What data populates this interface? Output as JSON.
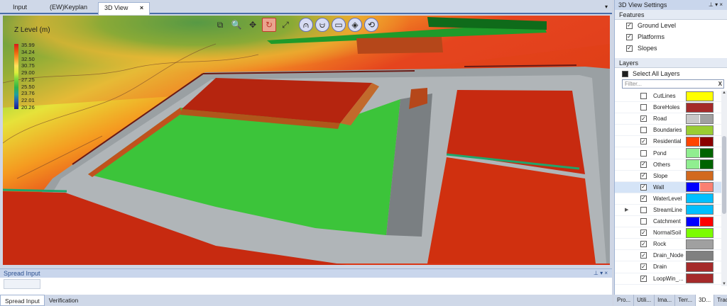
{
  "document_tabs": {
    "input": "Input",
    "keyplan": "(EW)Keyplan",
    "view3d": "3D View",
    "close_glyph": "×",
    "dropdown_glyph": "▾"
  },
  "legend": {
    "title": "Z Level (m)",
    "values": [
      "35.99",
      "34.24",
      "32.50",
      "30.75",
      "29.00",
      "27.25",
      "25.50",
      "23.76",
      "22.01",
      "20.26"
    ],
    "colors": [
      "#d7191c",
      "#ec5a0c",
      "#f89b29",
      "#fee05a",
      "#d9ef3a",
      "#6fd23b",
      "#2fb34a",
      "#1fa0a0",
      "#2755b5",
      "#1a1a8f"
    ]
  },
  "toolbar": [
    {
      "name": "zoom-window-icon",
      "glyph": "⧉",
      "style": "plain"
    },
    {
      "name": "zoom-icon",
      "glyph": "🔍",
      "style": "plain"
    },
    {
      "name": "pan-icon",
      "glyph": "✥",
      "style": "plain"
    },
    {
      "name": "rotate-icon",
      "glyph": "↻",
      "style": "active"
    },
    {
      "name": "zoom-extents-icon",
      "glyph": "⤢",
      "style": "plain"
    },
    {
      "name": "section-view-icon",
      "glyph": "⩀",
      "style": "round"
    },
    {
      "name": "profile-view-icon",
      "glyph": "⩁",
      "style": "round"
    },
    {
      "name": "plan-view-icon",
      "glyph": "▭",
      "style": "round"
    },
    {
      "name": "iso-view-icon",
      "glyph": "◈",
      "style": "round"
    },
    {
      "name": "settings-view-icon",
      "glyph": "⟲",
      "style": "round"
    }
  ],
  "settings": {
    "title": "3D View Settings",
    "pin_glyphs": "⊥ ▾ ×",
    "features_label": "Features",
    "features": [
      {
        "label": "Ground Level",
        "checked": true
      },
      {
        "label": "Platforms",
        "checked": true
      },
      {
        "label": "Slopes",
        "checked": true
      }
    ],
    "layers_label": "Layers",
    "select_all_label": "Select All Layers",
    "filter_placeholder": "Filter...",
    "filter_clear": "X",
    "layers": [
      {
        "label": "CutLines",
        "checked": false,
        "colors": [
          "#ffff00"
        ]
      },
      {
        "label": "BoreHoles",
        "checked": false,
        "colors": [
          "#a52a2a"
        ]
      },
      {
        "label": "Road",
        "checked": true,
        "colors": [
          "#c8c8c8",
          "#a0a0a0"
        ]
      },
      {
        "label": "Boundaries",
        "checked": false,
        "colors": [
          "#9acd32"
        ]
      },
      {
        "label": "Residential",
        "checked": true,
        "colors": [
          "#ff4500",
          "#8b0000"
        ]
      },
      {
        "label": "Pond",
        "checked": false,
        "colors": [
          "#90ee90",
          "#006400"
        ]
      },
      {
        "label": "Others",
        "checked": true,
        "colors": [
          "#90ee90",
          "#006400"
        ]
      },
      {
        "label": "Slope",
        "checked": true,
        "colors": [
          "#d2691e"
        ]
      },
      {
        "label": "Wall",
        "checked": true,
        "colors": [
          "#0000ff",
          "#fa8072"
        ],
        "selected": true
      },
      {
        "label": "WaterLevel",
        "checked": true,
        "colors": [
          "#00bfff"
        ]
      },
      {
        "label": "StreamLine",
        "checked": false,
        "colors": [
          "#00bfff"
        ],
        "expander": true
      },
      {
        "label": "Catchment",
        "checked": false,
        "colors": [
          "#0000ff",
          "#ff0000"
        ]
      },
      {
        "label": "NormalSoil",
        "checked": true,
        "colors": [
          "#7cfc00"
        ]
      },
      {
        "label": "Rock",
        "checked": true,
        "colors": [
          "#a0a0a0"
        ]
      },
      {
        "label": "Drain_Node",
        "checked": true,
        "colors": [
          "#808080"
        ]
      },
      {
        "label": "Drain",
        "checked": true,
        "colors": [
          "#a52a2a"
        ]
      },
      {
        "label": "LoopWin_...",
        "checked": true,
        "colors": [
          "#a52a2a"
        ]
      }
    ],
    "tabs": [
      "Pro...",
      "Utili...",
      "Ima...",
      "Terr...",
      "3D...",
      "Trac..."
    ]
  },
  "spread": {
    "title": "Spread Input",
    "pin_glyphs": "⊥ ▾ ×"
  },
  "bottom_tabs": [
    "Spread Input",
    "Verification"
  ]
}
